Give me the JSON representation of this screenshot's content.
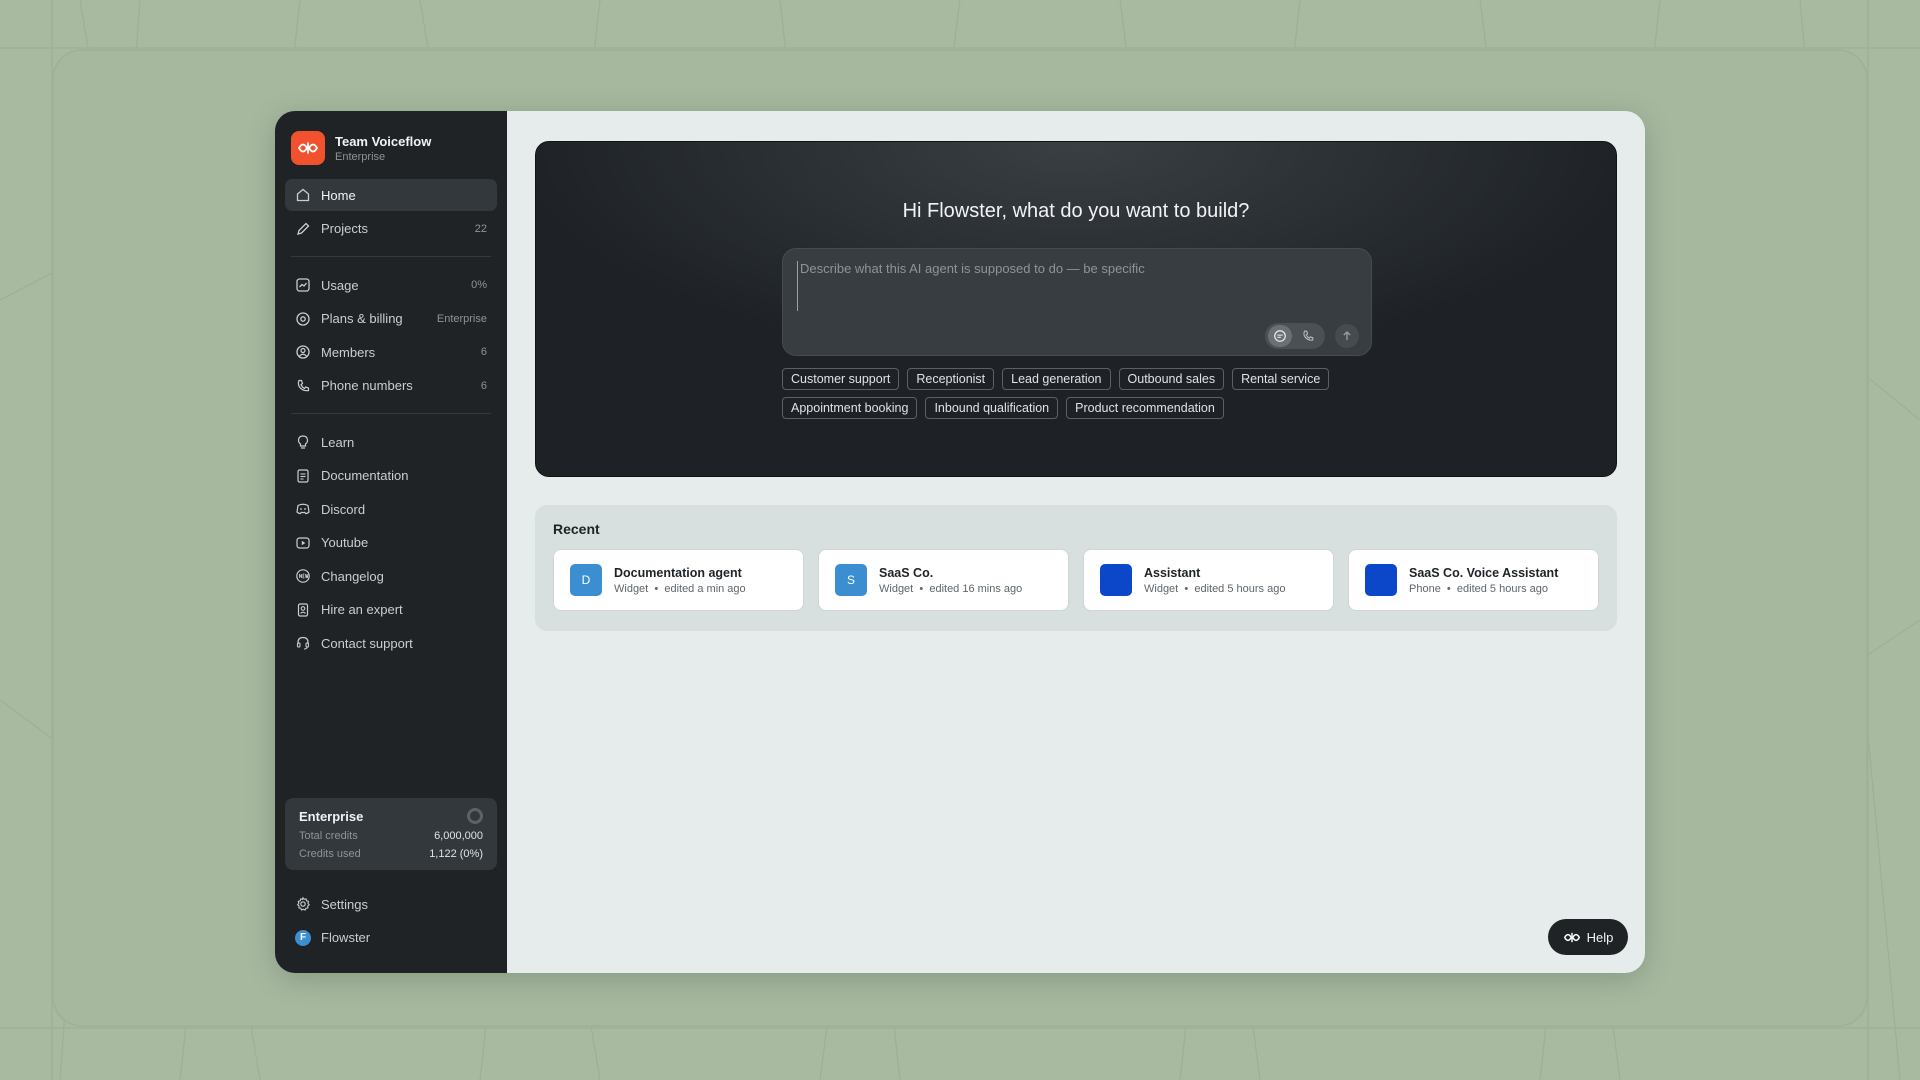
{
  "team": {
    "name": "Team Voiceflow",
    "plan": "Enterprise"
  },
  "nav_primary": [
    {
      "label": "Home",
      "meta": "",
      "icon": "home-icon"
    },
    {
      "label": "Projects",
      "meta": "22",
      "icon": "pencil-icon"
    }
  ],
  "nav_account": [
    {
      "label": "Usage",
      "meta": "0%",
      "icon": "chart-icon"
    },
    {
      "label": "Plans & billing",
      "meta": "Enterprise",
      "icon": "billing-icon"
    },
    {
      "label": "Members",
      "meta": "6",
      "icon": "user-icon"
    },
    {
      "label": "Phone numbers",
      "meta": "6",
      "icon": "phone-icon"
    }
  ],
  "nav_resources": [
    {
      "label": "Learn",
      "icon": "lightbulb-icon"
    },
    {
      "label": "Documentation",
      "icon": "document-icon"
    },
    {
      "label": "Discord",
      "icon": "discord-icon"
    },
    {
      "label": "Youtube",
      "icon": "play-icon"
    },
    {
      "label": "Changelog",
      "icon": "new-badge-icon"
    },
    {
      "label": "Hire an expert",
      "icon": "expert-icon"
    },
    {
      "label": "Contact support",
      "icon": "headset-icon"
    }
  ],
  "credits": {
    "title": "Enterprise",
    "total_label": "Total credits",
    "total_value": "6,000,000",
    "used_label": "Credits used",
    "used_value": "1,122 (0%)"
  },
  "footer": {
    "settings": "Settings",
    "user_initial": "F",
    "user_name": "Flowster"
  },
  "hero": {
    "title": "Hi Flowster, what do you want to build?",
    "placeholder": "Describe what this AI agent is supposed to do — be specific"
  },
  "chips_row1": [
    "Customer support",
    "Receptionist",
    "Lead generation",
    "Outbound sales",
    "Rental service"
  ],
  "chips_row2": [
    "Appointment booking",
    "Inbound qualification",
    "Product recommendation"
  ],
  "recent": {
    "title": "Recent",
    "items": [
      {
        "initial": "D",
        "color": "#3b8fd1",
        "name": "Documentation agent",
        "type": "Widget",
        "edited": "edited a min ago"
      },
      {
        "initial": "S",
        "color": "#3b8fd1",
        "name": "SaaS Co.",
        "type": "Widget",
        "edited": "edited 16 mins ago"
      },
      {
        "initial": "",
        "color": "#0d47c9",
        "name": "Assistant",
        "type": "Widget",
        "edited": "edited 5 hours ago"
      },
      {
        "initial": "",
        "color": "#0d47c9",
        "name": "SaaS Co. Voice Assistant",
        "type": "Phone",
        "edited": "edited 5 hours ago"
      }
    ]
  },
  "help": {
    "label": "Help"
  },
  "colors": {
    "brand": "#f2512d",
    "sidebar": "#1f2326",
    "accent": "#3b8fd1"
  }
}
